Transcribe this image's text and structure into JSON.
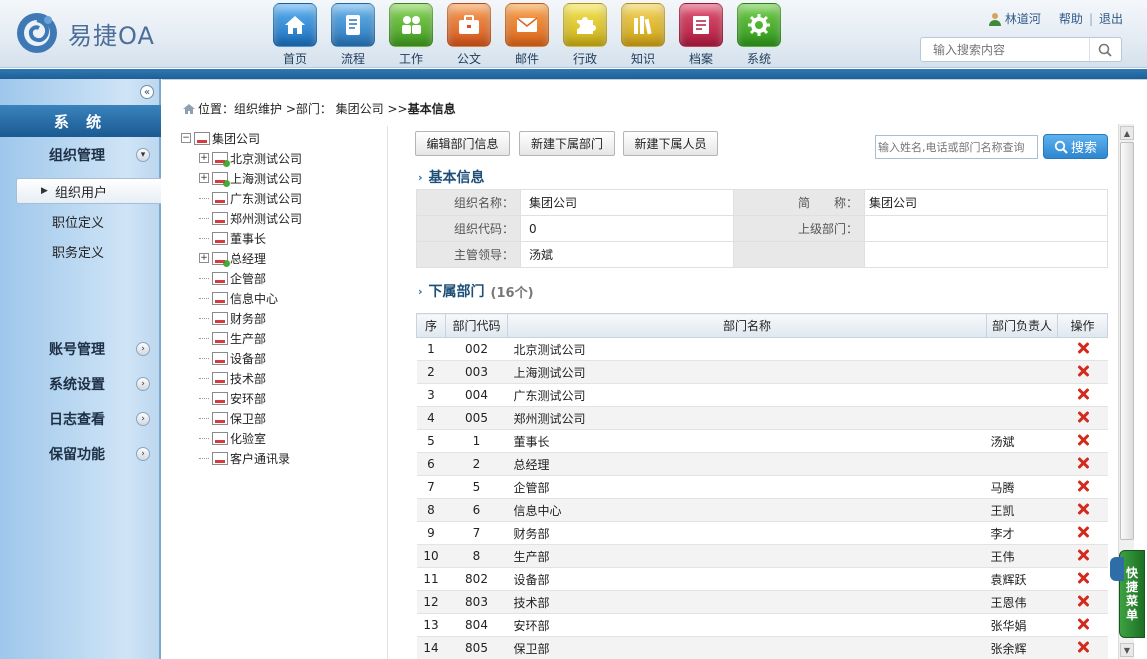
{
  "header": {
    "logo_text": "易捷OA",
    "user_name": "林道河",
    "help_label": "帮助",
    "logout_label": "退出",
    "search_placeholder": "输入搜索内容",
    "nav": [
      {
        "label": "首页",
        "icon": "home-icon",
        "color": "#1a7fd0"
      },
      {
        "label": "流程",
        "icon": "flow-icon",
        "color": "#2f86c9"
      },
      {
        "label": "工作",
        "icon": "work-icon",
        "color": "#5cb531"
      },
      {
        "label": "公文",
        "icon": "briefcase-icon",
        "color": "#e56f1e"
      },
      {
        "label": "邮件",
        "icon": "mail-icon",
        "color": "#e9731c"
      },
      {
        "label": "行政",
        "icon": "puzzle-icon",
        "color": "#d9c31a"
      },
      {
        "label": "知识",
        "icon": "books-icon",
        "color": "#e2b81a"
      },
      {
        "label": "档案",
        "icon": "archive-icon",
        "color": "#c7274e"
      },
      {
        "label": "系统",
        "icon": "gear-icon",
        "color": "#48ae2e"
      }
    ]
  },
  "sidebar": {
    "title": "系 统",
    "groups": [
      {
        "label": "组织管理",
        "expanded": true
      },
      {
        "label": "账号管理",
        "expanded": false
      },
      {
        "label": "系统设置",
        "expanded": false
      },
      {
        "label": "日志查看",
        "expanded": false
      },
      {
        "label": "保留功能",
        "expanded": false
      }
    ],
    "subitems": [
      {
        "label": "组织用户",
        "active": true
      },
      {
        "label": "职位定义",
        "active": false
      },
      {
        "label": "职务定义",
        "active": false
      }
    ]
  },
  "breadcrumb": {
    "prefix": "位置：组织维护 >部门： 集团公司 >> ",
    "current": "基本信息"
  },
  "tree": {
    "root": "集团公司",
    "children": [
      {
        "label": "北京测试公司",
        "expandable": true
      },
      {
        "label": "上海测试公司",
        "expandable": true
      },
      {
        "label": "广东测试公司",
        "expandable": false
      },
      {
        "label": "郑州测试公司",
        "expandable": false
      },
      {
        "label": "董事长",
        "expandable": false
      },
      {
        "label": "总经理",
        "expandable": true
      },
      {
        "label": "企管部",
        "expandable": false
      },
      {
        "label": "信息中心",
        "expandable": false
      },
      {
        "label": "财务部",
        "expandable": false
      },
      {
        "label": "生产部",
        "expandable": false
      },
      {
        "label": "设备部",
        "expandable": false
      },
      {
        "label": "技术部",
        "expandable": false
      },
      {
        "label": "安环部",
        "expandable": false
      },
      {
        "label": "保卫部",
        "expandable": false
      },
      {
        "label": "化验室",
        "expandable": false
      },
      {
        "label": "客户通讯录",
        "expandable": false
      }
    ]
  },
  "toolbar": {
    "edit_label": "编辑部门信息",
    "new_dept_label": "新建下属部门",
    "new_person_label": "新建下属人员",
    "find_placeholder": "输入姓名,电话或部门名称查询",
    "find_label": "搜索"
  },
  "basic_info": {
    "title": "基本信息",
    "org_name_label": "组织名称：",
    "org_name": "集团公司",
    "short_name_label": "简　　称：",
    "short_name": "集团公司",
    "org_code_label": "组织代码：",
    "org_code": "0",
    "parent_label": "上级部门：",
    "parent": "",
    "leader_label": "主管领导：",
    "leader": "汤斌"
  },
  "sub_depts": {
    "title": "下属部门",
    "count": "(16个)",
    "headers": [
      "序",
      "部门代码",
      "部门名称",
      "部门负责人",
      "操作"
    ],
    "rows": [
      [
        "1",
        "002",
        "北京测试公司",
        ""
      ],
      [
        "2",
        "003",
        "上海测试公司",
        ""
      ],
      [
        "3",
        "004",
        "广东测试公司",
        ""
      ],
      [
        "4",
        "005",
        "郑州测试公司",
        ""
      ],
      [
        "5",
        "1",
        "董事长",
        "汤斌"
      ],
      [
        "6",
        "2",
        "总经理",
        ""
      ],
      [
        "7",
        "5",
        "企管部",
        "马腾"
      ],
      [
        "8",
        "6",
        "信息中心",
        "王凯"
      ],
      [
        "9",
        "7",
        "财务部",
        "李才"
      ],
      [
        "10",
        "8",
        "生产部",
        "王伟"
      ],
      [
        "11",
        "802",
        "设备部",
        "袁辉跃"
      ],
      [
        "12",
        "803",
        "技术部",
        "王恩伟"
      ],
      [
        "13",
        "804",
        "安环部",
        "张华娟"
      ],
      [
        "14",
        "805",
        "保卫部",
        "张余辉"
      ]
    ]
  },
  "quick_menu": {
    "label": [
      "快",
      "捷",
      "菜",
      "单"
    ]
  }
}
